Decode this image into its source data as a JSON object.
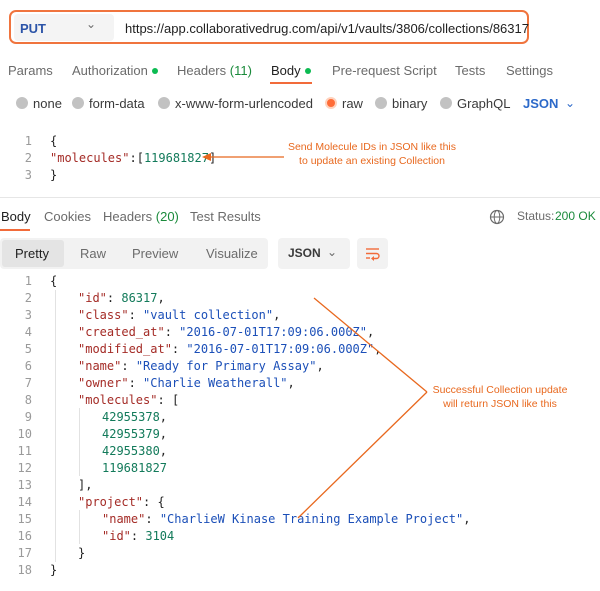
{
  "request": {
    "method": "PUT",
    "url": "https://app.collaborativedrug.com/api/v1/vaults/3806/collections/86317"
  },
  "request_tabs": {
    "params": "Params",
    "authorization": "Authorization",
    "headers": "Headers",
    "headers_count": "(11)",
    "body": "Body",
    "pre_request": "Pre-request Script",
    "tests": "Tests",
    "settings": "Settings"
  },
  "body_types": {
    "none": "none",
    "form_data": "form-data",
    "urlencoded": "x-www-form-urlencoded",
    "raw": "raw",
    "binary": "binary",
    "graphql": "GraphQL",
    "selected": "raw",
    "language": "JSON"
  },
  "request_body": {
    "line_numbers": [
      "1",
      "2",
      "3"
    ],
    "open": "{",
    "key": "\"molecules\"",
    "sep": ":[",
    "value": "119681827",
    "close_bracket": "]",
    "close": "}"
  },
  "annotations": {
    "request_note_1": "Send Molecule IDs in JSON like this",
    "request_note_2": "to update an existing Collection",
    "response_note_1": "Successful Collection update",
    "response_note_2": "will return JSON like this"
  },
  "response_tabs": {
    "body": "Body",
    "cookies": "Cookies",
    "headers": "Headers",
    "headers_count": "(20)",
    "test_results": "Test Results",
    "status_label": "Status:",
    "status_value": "200 OK"
  },
  "response_toolbar": {
    "pretty": "Pretty",
    "raw": "Raw",
    "preview": "Preview",
    "visualize": "Visualize",
    "format": "JSON"
  },
  "response_body": {
    "line_numbers": [
      "1",
      "2",
      "3",
      "4",
      "5",
      "6",
      "7",
      "8",
      "9",
      "10",
      "11",
      "12",
      "13",
      "14",
      "15",
      "16",
      "17",
      "18"
    ],
    "l1": "{",
    "l2_key": "\"id\"",
    "l2_val": "86317",
    "l3_key": "\"class\"",
    "l3_val": "\"vault collection\"",
    "l4_key": "\"created_at\"",
    "l4_val": "\"2016-07-01T17:09:06.000Z\"",
    "l5_key": "\"modified_at\"",
    "l5_val": "\"2016-07-01T17:09:06.000Z\"",
    "l6_key": "\"name\"",
    "l6_val": "\"Ready for Primary Assay\"",
    "l7_key": "\"owner\"",
    "l7_val": "\"Charlie Weatherall\"",
    "l8_key": "\"molecules\"",
    "l8_val": "[",
    "l9_val": "42955378",
    "l10_val": "42955379",
    "l11_val": "42955380",
    "l12_val": "119681827",
    "l13": "],",
    "l14_key": "\"project\"",
    "l14_val": "{",
    "l15_key": "\"name\"",
    "l15_val": "\"CharlieW Kinase Training Example Project\"",
    "l16_key": "\"id\"",
    "l16_val": "3104",
    "l17": "}",
    "l18": "}"
  },
  "colors": {
    "accent": "#ff6c37",
    "annotation": "#e8681e",
    "method": "#2c54a8",
    "status_ok": "#1a8a3b",
    "json_key": "#a42b26",
    "json_string": "#1b4fb8",
    "json_number": "#127a5a"
  }
}
